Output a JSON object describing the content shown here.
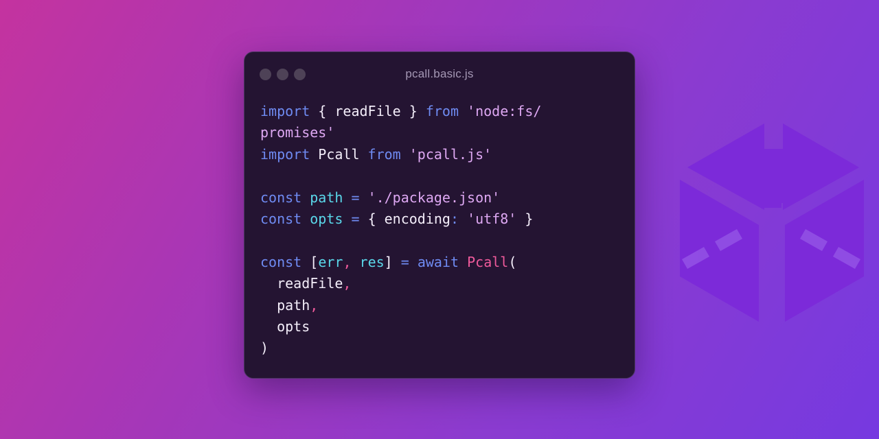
{
  "window": {
    "title": "pcall.basic.js"
  },
  "code": {
    "lines": [
      [
        {
          "t": "import",
          "c": "kw"
        },
        {
          "t": " { ",
          "c": "pn"
        },
        {
          "t": "readFile",
          "c": "pn"
        },
        {
          "t": " } ",
          "c": "pn"
        },
        {
          "t": "from",
          "c": "kw"
        },
        {
          "t": " ",
          "c": "pn"
        },
        {
          "t": "'node:fs/",
          "c": "str"
        }
      ],
      [
        {
          "t": "promises'",
          "c": "str"
        }
      ],
      [
        {
          "t": "import",
          "c": "kw"
        },
        {
          "t": " Pcall ",
          "c": "pn"
        },
        {
          "t": "from",
          "c": "kw"
        },
        {
          "t": " ",
          "c": "pn"
        },
        {
          "t": "'pcall.js'",
          "c": "str"
        }
      ],
      [],
      [
        {
          "t": "const",
          "c": "kw"
        },
        {
          "t": " ",
          "c": "pn"
        },
        {
          "t": "path",
          "c": "var"
        },
        {
          "t": " = ",
          "c": "kw"
        },
        {
          "t": "'./package.json'",
          "c": "str"
        }
      ],
      [
        {
          "t": "const",
          "c": "kw"
        },
        {
          "t": " ",
          "c": "pn"
        },
        {
          "t": "opts",
          "c": "var"
        },
        {
          "t": " = ",
          "c": "kw"
        },
        {
          "t": "{ encoding",
          "c": "pn"
        },
        {
          "t": ":",
          "c": "kw"
        },
        {
          "t": " ",
          "c": "pn"
        },
        {
          "t": "'utf8'",
          "c": "str"
        },
        {
          "t": " }",
          "c": "pn"
        }
      ],
      [],
      [
        {
          "t": "const",
          "c": "kw"
        },
        {
          "t": " [",
          "c": "pn"
        },
        {
          "t": "err",
          "c": "var"
        },
        {
          "t": ", ",
          "c": "cm"
        },
        {
          "t": "res",
          "c": "var"
        },
        {
          "t": "] ",
          "c": "pn"
        },
        {
          "t": "=",
          "c": "kw"
        },
        {
          "t": " ",
          "c": "pn"
        },
        {
          "t": "await",
          "c": "kw"
        },
        {
          "t": " ",
          "c": "pn"
        },
        {
          "t": "Pcall",
          "c": "fn"
        },
        {
          "t": "(",
          "c": "pn"
        }
      ],
      [
        {
          "t": "  readFile",
          "c": "pn"
        },
        {
          "t": ",",
          "c": "cm"
        }
      ],
      [
        {
          "t": "  path",
          "c": "pn"
        },
        {
          "t": ",",
          "c": "cm"
        }
      ],
      [
        {
          "t": "  opts",
          "c": "pn"
        }
      ],
      [
        {
          "t": ")",
          "c": "pn"
        }
      ]
    ]
  },
  "icons": [
    "window-control-dot",
    "pcall-logo"
  ],
  "colors": {
    "keyword": "#6f8bf2",
    "string": "#dea8f3",
    "variable": "#5ad7ea",
    "function": "#ef5a9b",
    "text": "#f4eefa",
    "window_bg": "#241432",
    "logo": "#7c2ad9"
  }
}
